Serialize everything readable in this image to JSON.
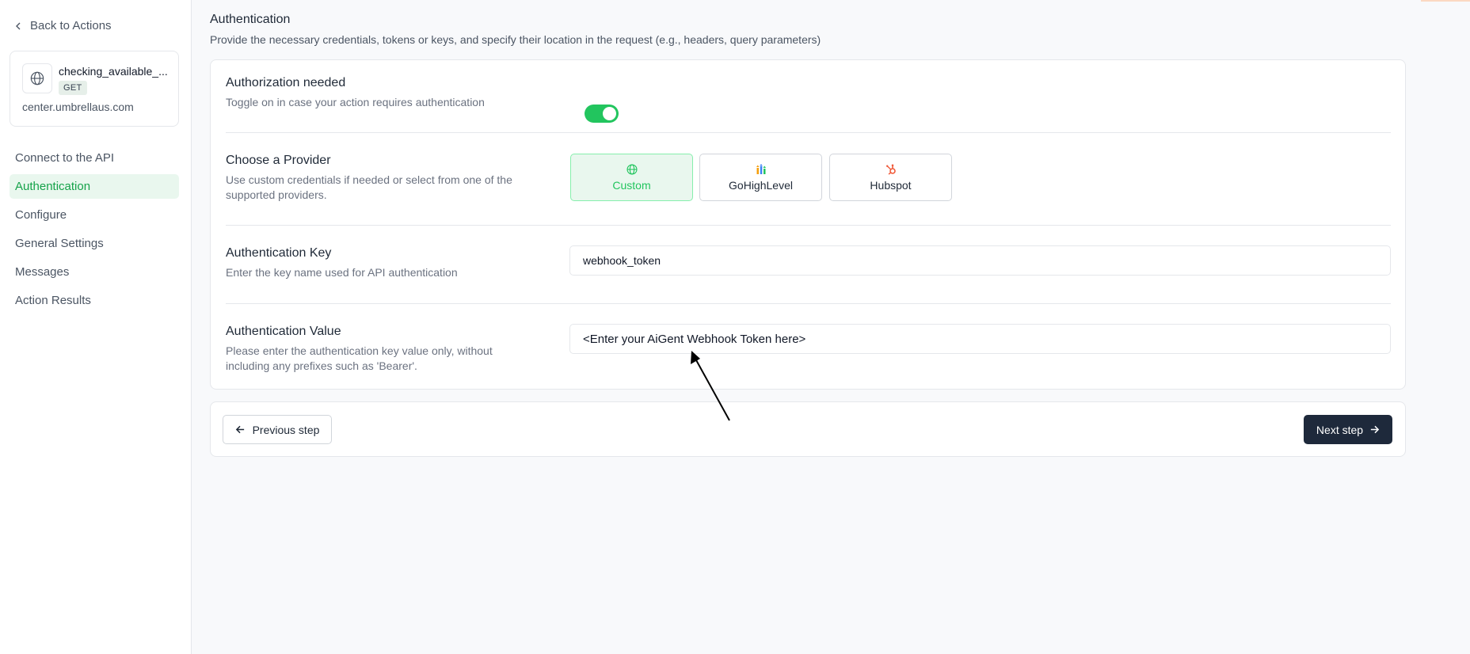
{
  "sidebar": {
    "back_label": "Back to Actions",
    "action": {
      "name": "checking_available_...",
      "method": "GET",
      "host": "center.umbrellaus.com"
    },
    "nav": [
      {
        "label": "Connect to the API"
      },
      {
        "label": "Authentication"
      },
      {
        "label": "Configure"
      },
      {
        "label": "General Settings"
      },
      {
        "label": "Messages"
      },
      {
        "label": "Action Results"
      }
    ],
    "active_index": 1
  },
  "main": {
    "title": "Authentication",
    "description": "Provide the necessary credentials, tokens or keys, and specify their location in the request (e.g., headers, query parameters)",
    "auth_needed": {
      "label": "Authorization needed",
      "help": "Toggle on in case your action requires authentication",
      "enabled": true
    },
    "provider": {
      "label": "Choose a Provider",
      "help": "Use custom credentials if needed or select from one of the supported providers.",
      "options": [
        {
          "label": "Custom",
          "icon": "globe-icon"
        },
        {
          "label": "GoHighLevel",
          "icon": "gohighlevel-icon"
        },
        {
          "label": "Hubspot",
          "icon": "hubspot-icon"
        }
      ],
      "selected": "Custom"
    },
    "auth_key": {
      "label": "Authentication Key",
      "help": "Enter the key name used for API authentication",
      "value": "webhook_token"
    },
    "auth_value": {
      "label": "Authentication Value",
      "help": "Please enter the authentication key value only, without including any prefixes such as 'Bearer'.",
      "value": "<Enter your AiGent Webhook Token here>"
    }
  },
  "footer": {
    "prev_label": "Previous step",
    "next_label": "Next step"
  },
  "colors": {
    "accent": "#22c55e",
    "primary_button": "#1e293b"
  }
}
